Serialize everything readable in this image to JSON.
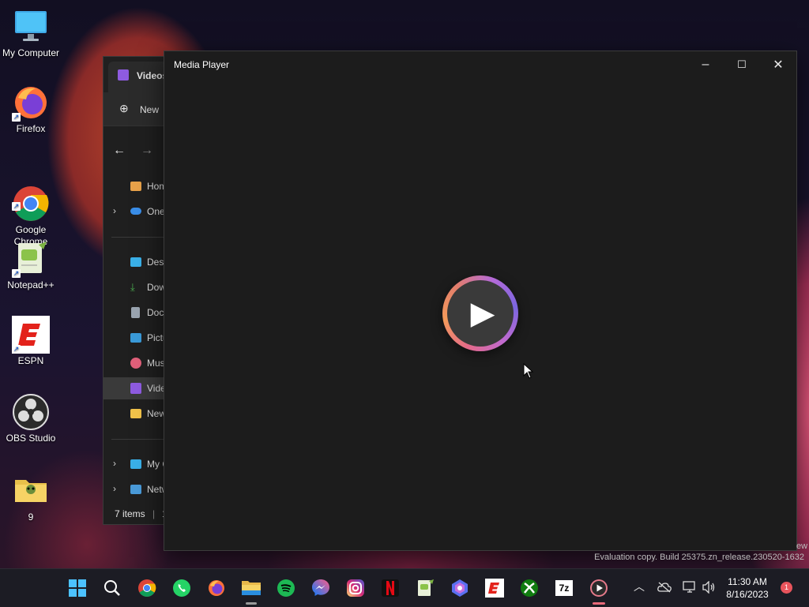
{
  "desktop": {
    "icons": [
      {
        "label": "My Computer",
        "name": "my-computer"
      },
      {
        "label": "Firefox",
        "name": "firefox"
      },
      {
        "label": "Google\nChrome",
        "name": "google-chrome"
      },
      {
        "label": "Notepad++",
        "name": "notepad-plus-plus"
      },
      {
        "label": "ESPN",
        "name": "espn"
      },
      {
        "label": "OBS Studio",
        "name": "obs-studio"
      },
      {
        "label": "9",
        "name": "folder-9"
      }
    ]
  },
  "explorer": {
    "tab_title": "Videos",
    "new_label": "New",
    "nav_items": [
      {
        "label": "Home",
        "name": "home"
      },
      {
        "label": "OneDrive",
        "name": "onedrive"
      },
      {
        "label": "Desktop",
        "name": "desktop"
      },
      {
        "label": "Downloads",
        "name": "downloads"
      },
      {
        "label": "Documents",
        "name": "documents"
      },
      {
        "label": "Pictures",
        "name": "pictures"
      },
      {
        "label": "Music",
        "name": "music"
      },
      {
        "label": "Videos",
        "name": "videos"
      },
      {
        "label": "New folder",
        "name": "new-folder"
      },
      {
        "label": "My Computer",
        "name": "my-computer"
      },
      {
        "label": "Network",
        "name": "network"
      }
    ],
    "status": "7 items",
    "status_sep": "|",
    "status_extra": "1"
  },
  "player": {
    "title": "Media Player",
    "minimize_glyph": "–",
    "maximize_glyph": "☐",
    "close_glyph": "✕",
    "play_glyph": "▶"
  },
  "watermark": {
    "text": "Evaluation copy. Build 25375.zn_release.230520-1632",
    "partial": "ew"
  },
  "taskbar": {
    "apps": [
      "start",
      "search",
      "chrome",
      "whatsapp",
      "firefox",
      "file-explorer",
      "spotify",
      "messenger",
      "instagram",
      "netflix",
      "notepad-plus-plus",
      "copilot",
      "espn",
      "xbox",
      "7zip",
      "media-player"
    ],
    "sevenzip_label": "7z",
    "time": "11:30 AM",
    "date": "8/16/2023",
    "notification_count": "1",
    "colors": {
      "accent": "#e86a7a",
      "taskbar": "#1c1c24"
    }
  }
}
